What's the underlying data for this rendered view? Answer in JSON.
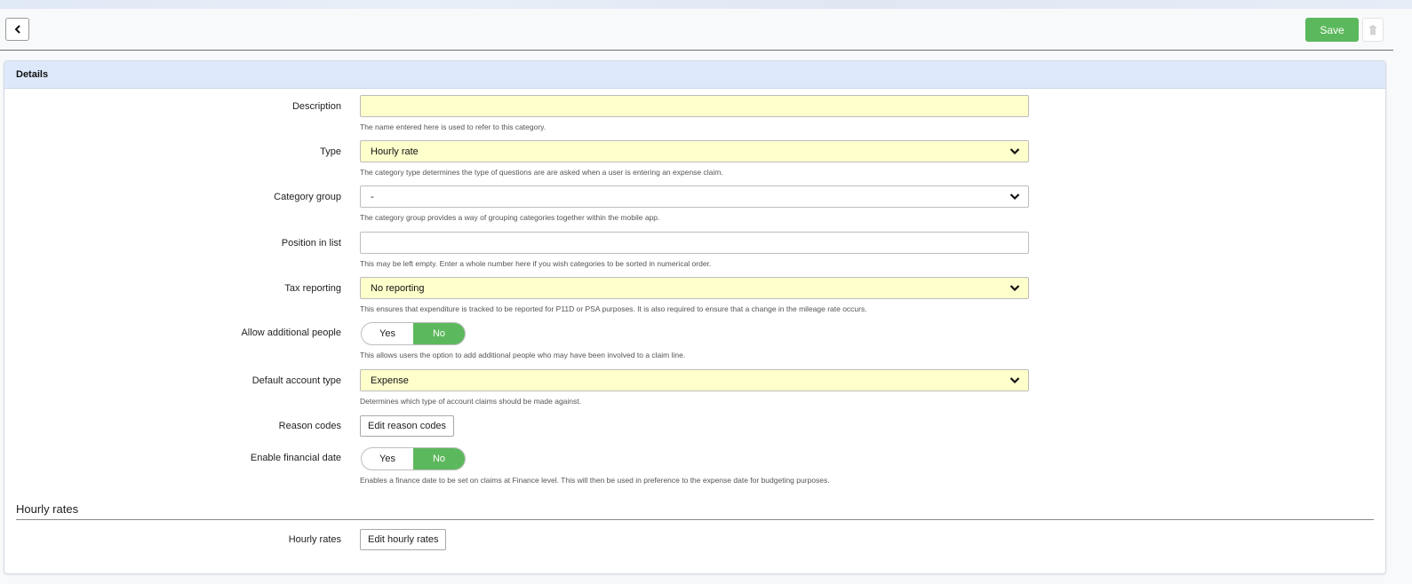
{
  "toolbar": {
    "back_icon": "chevron-left-icon",
    "save_label": "Save",
    "delete_icon": "trash-icon"
  },
  "details": {
    "header": "Details",
    "description": {
      "label": "Description",
      "value": "",
      "help": "The name entered here is used to refer to this category."
    },
    "type": {
      "label": "Type",
      "value": "Hourly rate",
      "help": "The category type determines the type of questions are are asked when a user is entering an expense claim."
    },
    "category_group": {
      "label": "Category group",
      "value": "-",
      "help": "The category group provides a way of grouping categories together within the mobile app."
    },
    "position": {
      "label": "Position in list",
      "value": "",
      "help": "This may be left empty. Enter a whole number here if you wish categories to be sorted in numerical order."
    },
    "tax_reporting": {
      "label": "Tax reporting",
      "value": "No reporting",
      "help": "This ensures that expenditure is tracked to be reported for P11D or PSA purposes. It is also required to ensure that a change in the mileage rate occurs."
    },
    "additional_people": {
      "label": "Allow additional people",
      "yes": "Yes",
      "no": "No",
      "selected": "No",
      "help": "This allows users the option to add additional people who may have been involved to a claim line."
    },
    "default_account": {
      "label": "Default account type",
      "value": "Expense",
      "help": "Determines which type of account claims should be made against."
    },
    "reason_codes": {
      "label": "Reason codes",
      "button": "Edit reason codes"
    },
    "financial_date": {
      "label": "Enable financial date",
      "yes": "Yes",
      "no": "No",
      "selected": "No",
      "help": "Enables a finance date to be set on claims at Finance level. This will then be used in preference to the expense date for budgeting purposes."
    }
  },
  "hourly": {
    "section_title": "Hourly rates",
    "label": "Hourly rates",
    "button": "Edit hourly rates"
  },
  "colors": {
    "accent_green": "#5cb85c",
    "required_yellow": "#ffffcc",
    "header_blue": "#dde9fb"
  }
}
